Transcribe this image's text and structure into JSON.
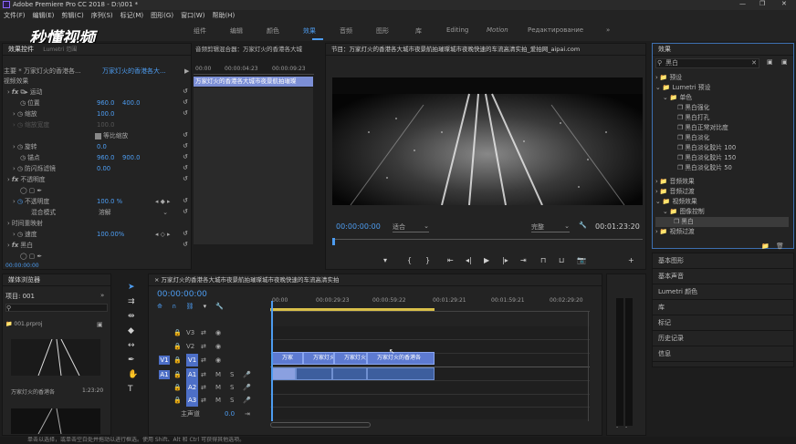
{
  "title": "Adobe Premiere Pro CC 2018 - D:\\001 *",
  "menu": [
    "文件(F)",
    "编辑(E)",
    "剪辑(C)",
    "序列(S)",
    "标记(M)",
    "图形(G)",
    "窗口(W)",
    "帮助(H)"
  ],
  "workspaces": [
    "组件",
    "编辑",
    "颜色",
    "效果",
    "音频",
    "图形",
    "库",
    "Editing",
    "Motion",
    "Редактирование"
  ],
  "watermark": "秒懂视频",
  "effect_controls": {
    "tab": "效果控件",
    "tab2": "Lumetri 范围",
    "tab3": "源：(无剪辑)",
    "tab4": "音频剪辑混合器：万家灯火的香港各大城",
    "master": "主要 * 万家灯火的香港各...",
    "seq": "万家灯火的香港各大...",
    "ruler": [
      "00:00",
      "00:00:04:23",
      "00:00:09:23"
    ],
    "clipbar": "万家灯火的香港各大城市夜景航拍璀璨",
    "section": "视频效果",
    "motion": "运动",
    "position": "位置",
    "pos_x": "960.0",
    "pos_y": "400.0",
    "scale": "缩放",
    "scale_v": "100.0",
    "scale_w": "缩放宽度",
    "scale_w_v": "100.0",
    "uniform": "等比缩放",
    "rotation": "旋转",
    "rotation_v": "0.0",
    "anchor": "锚点",
    "anchor_x": "960.0",
    "anchor_y": "900.0",
    "flicker": "防闪烁滤镜",
    "flicker_v": "0.00",
    "opacity": "不透明度",
    "opacity_p": "不透明度",
    "opacity_v": "100.0 %",
    "blend": "混合模式",
    "blend_v": "溶解",
    "timeremap": "时间重映射",
    "speed": "速度",
    "speed_v": "100.00%",
    "bw": "黑白",
    "tc": "00:00:00:00"
  },
  "program": {
    "title": "节目：万家灯火的香港各大城市夜景航拍璀璨城市夜晚快速的车流高清实拍_爱拍网_aipai.com",
    "tc_left": "00:00:00:00",
    "fit": "适合",
    "quality": "完整",
    "tc_right": "00:01:23:20"
  },
  "media": {
    "title": "媒体浏览器",
    "project": "项目: 001",
    "file": "001.prproj",
    "clip": "万家灯火的香港各",
    "clip_dur": "1:23:20"
  },
  "timeline": {
    "title": "万家灯火的香港各大城市夜景航拍璀璨城市夜晚快速的车流高清实拍",
    "tc": "00:00:00:00",
    "ruler": [
      "00:00",
      "00:00:29:23",
      "00:00:59:22",
      "00:01:29:21",
      "00:01:59:21",
      "00:02:29:20"
    ],
    "tracks": [
      "V3",
      "V2",
      "V1",
      "A1",
      "A2",
      "A3"
    ],
    "master": "主声道",
    "master_v": "0.0",
    "clips": [
      "万家",
      "万家灯火的",
      "万家灯火",
      "万家灯火的香港各"
    ]
  },
  "effects": {
    "title": "效果",
    "search": "黑白",
    "items": [
      "预设",
      "Lumetri 预设",
      "单色",
      "黑白强化",
      "黑白打孔",
      "黑白正常对比度",
      "黑白淡化",
      "黑白淡化胶片 100",
      "黑白淡化胶片 150",
      "黑白淡化胶片 50",
      "音频效果",
      "音频过渡",
      "视频效果",
      "图像控制",
      "黑白",
      "视频过渡"
    ]
  },
  "right_panels": [
    "基本图形",
    "基本声音",
    "Lumetri 颜色",
    "库",
    "标记",
    "历史记录",
    "信息"
  ],
  "meter": [
    "-",
    "-"
  ],
  "status": "单击以选择，或单击空白处并拖动以进行框选。使用 Shift、Alt 和 Ctrl 可获得其他选项。"
}
